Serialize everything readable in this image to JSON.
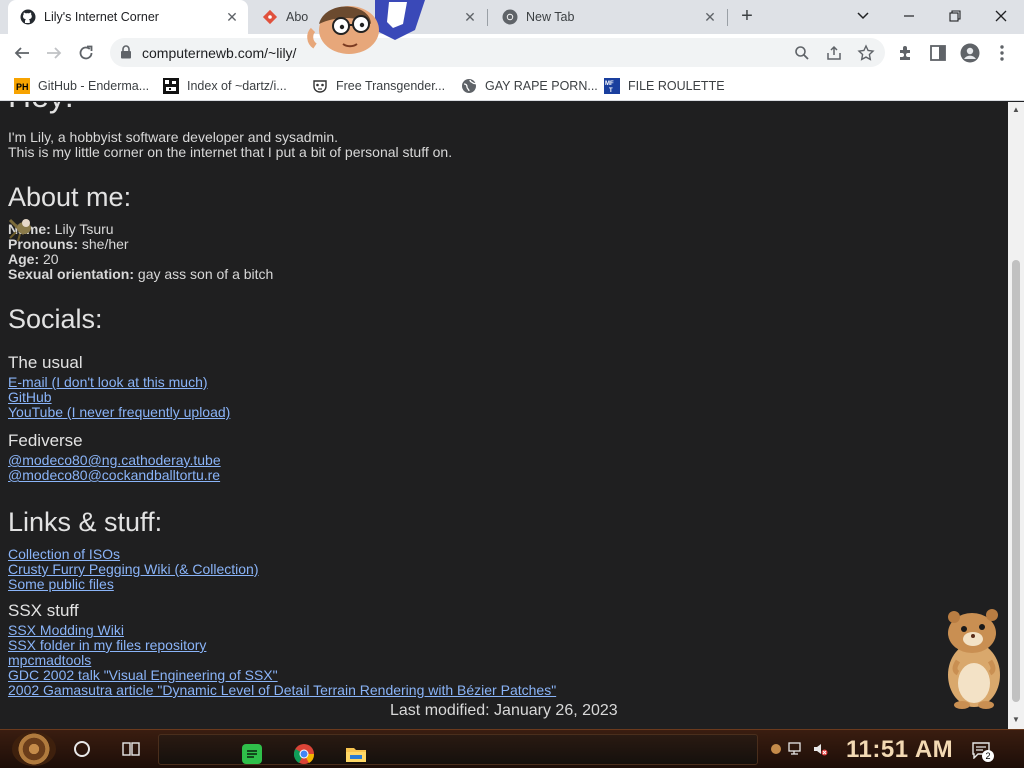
{
  "browser": {
    "tabs": [
      {
        "title": "Lily's Internet Corner",
        "active": true,
        "favicon": "github-octocat-icon"
      },
      {
        "title": "Abo",
        "active": false,
        "favicon": "gitea-diamond-icon"
      },
      {
        "title": "New Tab",
        "active": false,
        "favicon": "chrome-icon"
      }
    ],
    "new_tab_symbol": "+",
    "url": "computernewb.com/~lily/",
    "bookmarks": [
      {
        "label": "GitHub - Enderma...",
        "icon": "ph-logo-icon"
      },
      {
        "label": "Index of ~dartz/i...",
        "icon": "pixel-folder-icon"
      },
      {
        "label": "Free Transgender...",
        "icon": "mask-icon"
      },
      {
        "label": "GAY RAPE PORN...",
        "icon": "globe-icon"
      },
      {
        "label": "FILE ROULETTE",
        "icon": "mft-icon"
      }
    ]
  },
  "page": {
    "heading_partial": "Hey!",
    "intro": [
      "I'm Lily, a hobbyist software developer and sysadmin.",
      "This is my little corner on the internet that I put a bit of personal stuff on."
    ],
    "about": {
      "heading": "About me:",
      "rows": [
        {
          "label": "Name:",
          "value": " Lily Tsuru"
        },
        {
          "label": "Pronouns:",
          "value": " she/her"
        },
        {
          "label": "Age:",
          "value": " 20"
        },
        {
          "label": "Sexual orientation:",
          "value": " gay ass son of a bitch"
        }
      ]
    },
    "socials": {
      "heading": "Socials:",
      "usual_heading": "The usual",
      "usual_links": [
        "E-mail (I don't look at this much)",
        "GitHub",
        "YouTube (I never frequently upload)"
      ],
      "fediverse_heading": "Fediverse",
      "fediverse_links": [
        "@modeco80@ng.cathoderay.tube",
        "@modeco80@cockandballtortu.re"
      ]
    },
    "links": {
      "heading": "Links & stuff:",
      "items": [
        "Collection of ISOs",
        "Crusty Furry Pegging Wiki (& Collection)",
        "Some public files"
      ],
      "ssx_heading": "SSX stuff",
      "ssx_items": [
        "SSX Modding Wiki",
        "SSX folder in my files repository",
        "mpcmadtools",
        "GDC 2002 talk \"Visual Engineering of SSX\"",
        "2002 Gamasutra article \"Dynamic Level of Detail Terrain Rendering with Bézier Patches\""
      ]
    },
    "footer": "Last modified: January 26, 2023"
  },
  "taskbar": {
    "clock": "11:51 AM",
    "notification_count": "2"
  },
  "colors": {
    "page_bg": "#1f1f20",
    "link": "#8ab4f8",
    "text": "#d8d8d8",
    "clock": "#f3d9b3"
  }
}
